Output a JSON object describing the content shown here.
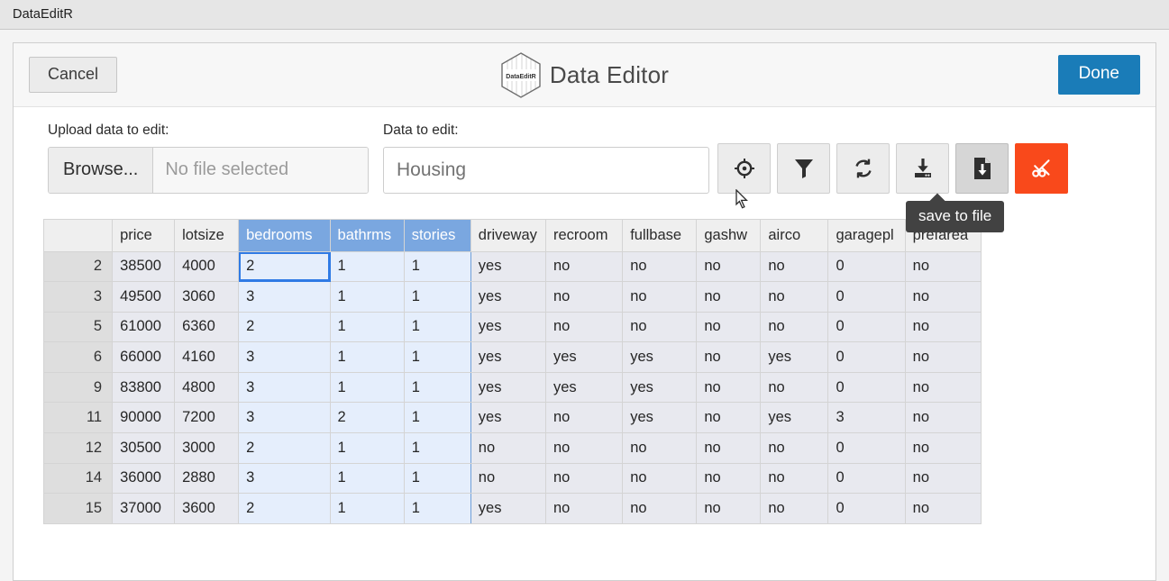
{
  "window": {
    "app_title": "DataEditR"
  },
  "header": {
    "cancel_label": "Cancel",
    "title": "Data Editor",
    "logo_text": "DataEditR",
    "done_label": "Done",
    "accent_done": "#1a7cb8"
  },
  "controls": {
    "upload_label": "Upload data to edit:",
    "browse_label": "Browse...",
    "file_placeholder": "No file selected",
    "data_label": "Data to edit:",
    "data_value": "Housing",
    "data_placeholder": "Housing"
  },
  "toolbar": {
    "buttons": [
      {
        "name": "select-icon",
        "title": "select"
      },
      {
        "name": "filter-icon",
        "title": "filter"
      },
      {
        "name": "sync-icon",
        "title": "sync"
      },
      {
        "name": "download-icon",
        "title": "download"
      },
      {
        "name": "save-to-file-icon",
        "title": "save to file"
      },
      {
        "name": "cut-icon",
        "title": "cut"
      }
    ],
    "danger_color": "#f9491b",
    "active_index": 4
  },
  "tooltip": {
    "text": "save to file"
  },
  "table": {
    "index_header": "",
    "columns": [
      "price",
      "lotsize",
      "bedrooms",
      "bathrms",
      "stories",
      "driveway",
      "recroom",
      "fullbase",
      "gashw",
      "airco",
      "garagepl",
      "prefarea"
    ],
    "selected_columns": [
      "bedrooms",
      "bathrms",
      "stories"
    ],
    "active_cell": {
      "row": 0,
      "column": "bedrooms"
    },
    "row_indices": [
      "2",
      "3",
      "5",
      "6",
      "9",
      "11",
      "12",
      "14",
      "15"
    ],
    "rows": [
      [
        "38500",
        "4000",
        "2",
        "1",
        "1",
        "yes",
        "no",
        "no",
        "no",
        "no",
        "0",
        "no"
      ],
      [
        "49500",
        "3060",
        "3",
        "1",
        "1",
        "yes",
        "no",
        "no",
        "no",
        "no",
        "0",
        "no"
      ],
      [
        "61000",
        "6360",
        "2",
        "1",
        "1",
        "yes",
        "no",
        "no",
        "no",
        "no",
        "0",
        "no"
      ],
      [
        "66000",
        "4160",
        "3",
        "1",
        "1",
        "yes",
        "yes",
        "yes",
        "no",
        "yes",
        "0",
        "no"
      ],
      [
        "83800",
        "4800",
        "3",
        "1",
        "1",
        "yes",
        "yes",
        "yes",
        "no",
        "no",
        "0",
        "no"
      ],
      [
        "90000",
        "7200",
        "3",
        "2",
        "1",
        "yes",
        "no",
        "yes",
        "no",
        "yes",
        "3",
        "no"
      ],
      [
        "30500",
        "3000",
        "2",
        "1",
        "1",
        "no",
        "no",
        "no",
        "no",
        "no",
        "0",
        "no"
      ],
      [
        "36000",
        "2880",
        "3",
        "1",
        "1",
        "no",
        "no",
        "no",
        "no",
        "no",
        "0",
        "no"
      ],
      [
        "37000",
        "3600",
        "2",
        "1",
        "1",
        "yes",
        "no",
        "no",
        "no",
        "no",
        "0",
        "no"
      ]
    ]
  }
}
